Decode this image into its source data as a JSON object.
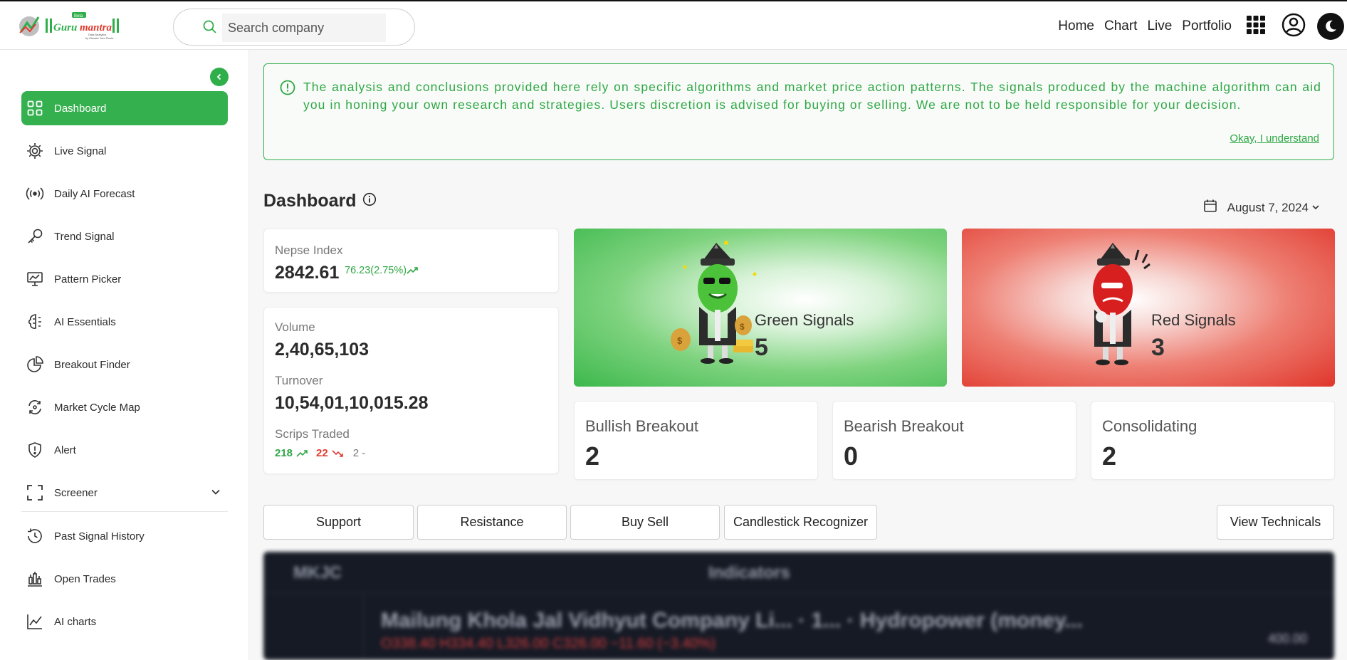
{
  "header": {
    "logo_text": "Gurumantra",
    "logo_badge": "Beta",
    "search": {
      "placeholder": "Search company"
    },
    "nav": {
      "home": "Home",
      "chart": "Chart",
      "live": "Live",
      "portfolio": "Portfolio"
    },
    "icons": [
      "search-icon",
      "apps-grid-icon",
      "user-account-icon",
      "moon-icon"
    ]
  },
  "sidebar": {
    "items": [
      {
        "label": "Dashboard",
        "icon": "dashboard-grid-icon",
        "active": true
      },
      {
        "label": "Live Signal",
        "icon": "live-signal-icon"
      },
      {
        "label": "Daily AI Forecast",
        "icon": "broadcast-icon"
      },
      {
        "label": "Trend Signal",
        "icon": "key-icon"
      },
      {
        "label": "Pattern Picker",
        "icon": "presentation-chart-icon"
      },
      {
        "label": "AI Essentials",
        "icon": "brain-icon"
      },
      {
        "label": "Breakout Finder",
        "icon": "pie-chart-icon"
      },
      {
        "label": "Market Cycle Map",
        "icon": "cycle-arrows-icon"
      },
      {
        "label": "Alert",
        "icon": "shield-alert-icon"
      },
      {
        "label": "Screener",
        "icon": "scan-frame-icon"
      },
      {
        "label": "Past Signal History",
        "icon": "history-icon"
      },
      {
        "label": "Open Trades",
        "icon": "bar-candles-icon"
      },
      {
        "label": "AI charts",
        "icon": "line-chart-icon"
      }
    ]
  },
  "notice": {
    "text": "The analysis and conclusions provided here rely on specific algorithms and market price action patterns. The signals produced by the machine algorithm can aid you in honing your own research and strategies. Users discretion is advised for buying or selling. We are not to be held responsible for your decision.",
    "ack": "Okay, I understand"
  },
  "dashboard": {
    "title": "Dashboard",
    "date": "August 7, 2024",
    "nepse": {
      "label": "Nepse Index",
      "value": "2842.61",
      "change": "76.23(2.75%)"
    },
    "volume": {
      "label": "Volume",
      "value": "2,40,65,103"
    },
    "turnover": {
      "label": "Turnover",
      "value": "10,54,01,10,015.28"
    },
    "scrips": {
      "label": "Scrips Traded",
      "up": "218",
      "down": "22",
      "flat": "2 -"
    },
    "green_signals": {
      "label": "Green Signals",
      "value": "5"
    },
    "red_signals": {
      "label": "Red Signals",
      "value": "3"
    },
    "bullish": {
      "label": "Bullish Breakout",
      "value": "2"
    },
    "bearish": {
      "label": "Bearish Breakout",
      "value": "0"
    },
    "consolidating": {
      "label": "Consolidating",
      "value": "2"
    }
  },
  "tabs": {
    "support": "Support",
    "resistance": "Resistance",
    "buy_sell": "Buy Sell",
    "candlestick": "Candlestick Recognizer",
    "view_technicals": "View Technicals"
  },
  "chart_preview": {
    "symbol": "MKJC",
    "indicators": "Indicators",
    "company": "Mailung Khola Jal Vidhyut Company Li... · 1... · Hydropower (money...",
    "ohlc": "O338.40 H334.40 L326.00 C326.00 −11.60 (−3.40%)",
    "price": "400.00"
  },
  "colors": {
    "accent": "#35b04f",
    "up": "#2fa745",
    "down": "#e03a2f"
  }
}
